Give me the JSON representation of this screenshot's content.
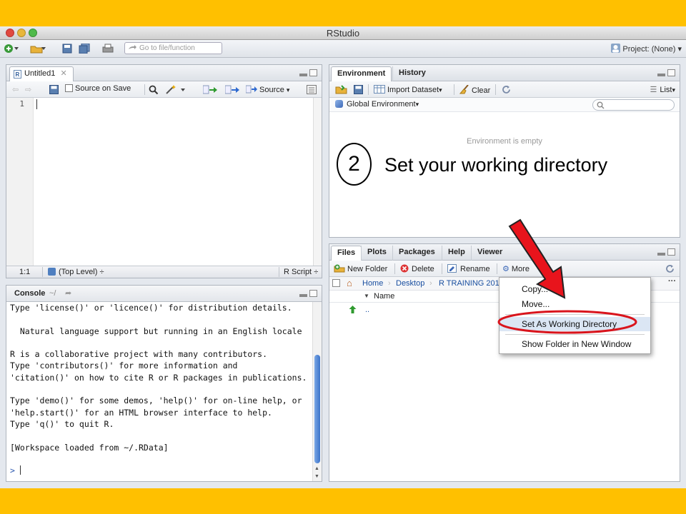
{
  "window": {
    "title": "RStudio"
  },
  "toolbar": {
    "goto_placeholder": "Go to file/function",
    "project_label": "Project: (None)",
    "project_menu": "▾"
  },
  "source_pane": {
    "tab_label": "Untitled1",
    "source_on_save": "Source on Save",
    "source_button": "Source",
    "line_number": "1",
    "status_position": "1:1",
    "status_scope": "(Top Level)",
    "status_type": "R Script",
    "up_down": "÷"
  },
  "console_pane": {
    "title": "Console",
    "path": "~/",
    "lines": [
      "Type 'license()' or 'licence()' for distribution details.",
      "",
      "  Natural language support but running in an English locale",
      "",
      "R is a collaborative project with many contributors.",
      "Type 'contributors()' for more information and",
      "'citation()' on how to cite R or R packages in publications.",
      "",
      "Type 'demo()' for some demos, 'help()' for on-line help, or",
      "'help.start()' for an HTML browser interface to help.",
      "Type 'q()' to quit R.",
      "",
      "[Workspace loaded from ~/.RData]",
      "",
      "> "
    ]
  },
  "env_pane": {
    "tabs": [
      "Environment",
      "History"
    ],
    "import_dataset": "Import Dataset",
    "clear": "Clear",
    "list_view": "List",
    "global_env": "Global Environment",
    "empty_message": "Environment is empty"
  },
  "files_pane": {
    "tabs": [
      "Files",
      "Plots",
      "Packages",
      "Help",
      "Viewer"
    ],
    "new_folder": "New Folder",
    "delete": "Delete",
    "rename": "Rename",
    "more": "More",
    "breadcrumb": [
      "Home",
      "Desktop",
      "R TRAINING 201"
    ],
    "column_name": "Name",
    "parent_dir": ".."
  },
  "more_menu": {
    "items": [
      "Copy...",
      "Move...",
      "Set As Working Directory",
      "Show Folder in New Window"
    ]
  },
  "annotation": {
    "step_number": "2",
    "step_text": "Set your working directory"
  },
  "colors": {
    "background": "#ffc000",
    "arrow": "#e8141c",
    "highlight_ellipse": "#d9141c"
  }
}
